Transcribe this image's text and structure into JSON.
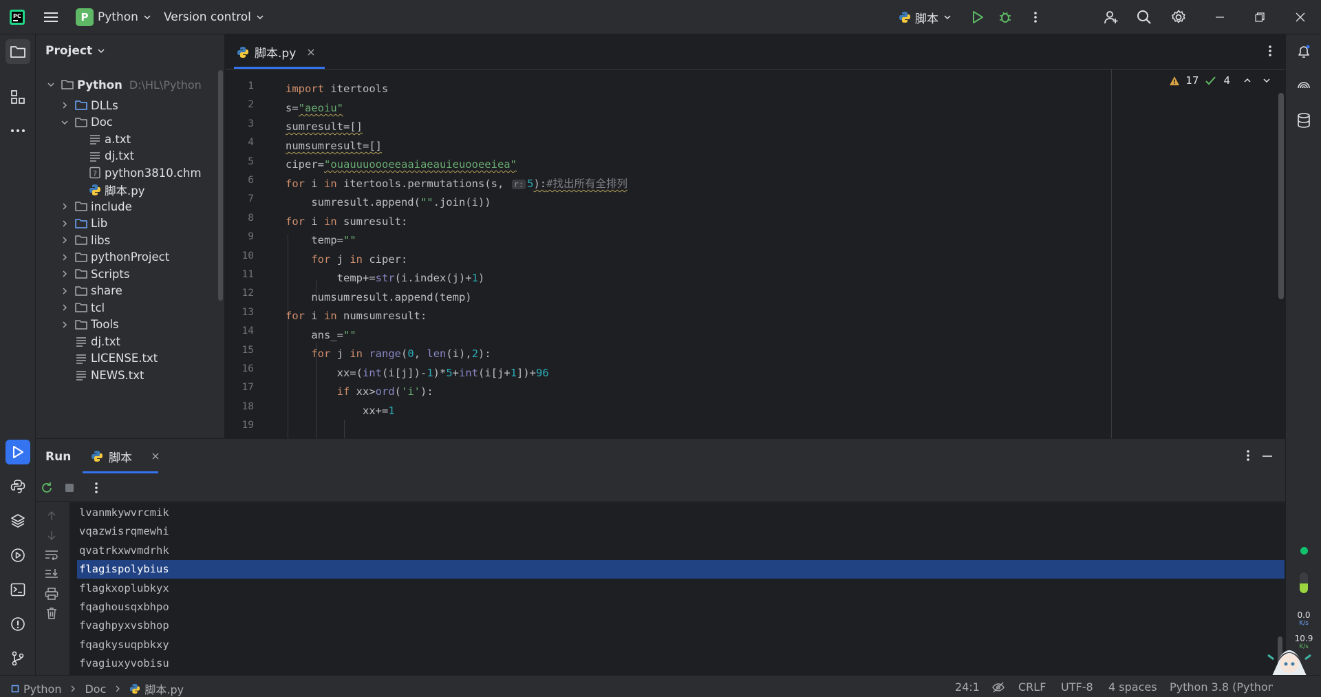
{
  "titlebar": {
    "menu_label": "Main Menu",
    "project_letter": "P",
    "project_name": "Python",
    "vcs_label": "Version control",
    "run_config": "脚本"
  },
  "project_panel": {
    "title": "Project",
    "root_name": "Python",
    "root_path": "D:\\HL\\Python",
    "items": [
      {
        "label": "DLLs",
        "type": "folder-blue"
      },
      {
        "label": "Doc",
        "type": "folder-open"
      },
      {
        "label": "a.txt",
        "type": "text"
      },
      {
        "label": "dj.txt",
        "type": "text"
      },
      {
        "label": "python3810.chm",
        "type": "chm"
      },
      {
        "label": "脚本.py",
        "type": "python"
      },
      {
        "label": "include",
        "type": "folder"
      },
      {
        "label": "Lib",
        "type": "folder-blue"
      },
      {
        "label": "libs",
        "type": "folder"
      },
      {
        "label": "pythonProject",
        "type": "folder"
      },
      {
        "label": "Scripts",
        "type": "folder"
      },
      {
        "label": "share",
        "type": "folder"
      },
      {
        "label": "tcl",
        "type": "folder"
      },
      {
        "label": "Tools",
        "type": "folder"
      },
      {
        "label": "dj.txt",
        "type": "text"
      },
      {
        "label": "LICENSE.txt",
        "type": "text"
      },
      {
        "label": "NEWS.txt",
        "type": "text"
      }
    ]
  },
  "editor": {
    "tab_label": "脚本.py",
    "warnings_count": "17",
    "ok_count": "4",
    "line_numbers": [
      "1",
      "2",
      "3",
      "4",
      "5",
      "6",
      "7",
      "8",
      "9",
      "10",
      "11",
      "12",
      "13",
      "14",
      "15",
      "16",
      "17",
      "18",
      "19"
    ],
    "code": {
      "l1_kw": "import",
      "l1_rest": " itertools",
      "l2_a": "s=",
      "l2_str": "\"aeoiu\"",
      "l3": "sumresult=[]",
      "l4": "numsumresult=[]",
      "l5_a": "ciper=",
      "l5_str": "\"ouauuuoooeeaaiaeauieuooeeiea\"",
      "l6_kw1": "for",
      "l6_b": " i ",
      "l6_kw2": "in",
      "l6_c": " itertools.permutations(s, ",
      "l6_hint": "r:",
      "l6_num": "5",
      "l6_d": "):",
      "l6_cmt": "#找出所有全排列",
      "l7_a": "    sumresult.append(",
      "l7_str": "\"\"",
      "l7_b": ".join(i))",
      "l8_kw1": "for",
      "l8_b": " i ",
      "l8_kw2": "in",
      "l8_c": " sumresult:",
      "l9_a": "    temp=",
      "l9_str": "\"\"",
      "l10_kw1": "for",
      "l10_b": " j ",
      "l10_kw2": "in",
      "l10_c": " ciper:",
      "l11_a": "        temp+=",
      "l11_bi": "str",
      "l11_b": "(i.index(j)+",
      "l11_num": "1",
      "l11_c": ")",
      "l12": "    numsumresult.append(temp)",
      "l13_kw1": "for",
      "l13_b": " i ",
      "l13_kw2": "in",
      "l13_c": " numsumresult:",
      "l14_a": "    ans_=",
      "l14_str": "\"\"",
      "l15_kw1": "for",
      "l15_b": " j ",
      "l15_kw2": "in",
      "l15_bi1": "range",
      "l15_c": "(",
      "l15_num1": "0",
      "l15_d": ", ",
      "l15_bi2": "len",
      "l15_e": "(i),",
      "l15_num2": "2",
      "l15_f": "):",
      "l16_a": "        xx=(",
      "l16_bi1": "int",
      "l16_b": "(i[j])-",
      "l16_num1": "1",
      "l16_c": ")*",
      "l16_num2": "5",
      "l16_d": "+",
      "l16_bi2": "int",
      "l16_e": "(i[j+",
      "l16_num3": "1",
      "l16_f": "])+",
      "l16_num4": "96",
      "l17_kw": "if",
      "l17_a": " xx>",
      "l17_bi": "ord",
      "l17_b": "(",
      "l17_str": "'i'",
      "l17_c": "):",
      "l18_a": "            xx+=",
      "l18_num": "1"
    }
  },
  "run_panel": {
    "title": "Run",
    "tab_label": "脚本",
    "output": [
      "lvanmkywvrcmik",
      "vqazwisrqmewhi",
      "qvatrkxwvmdrhk",
      "flagispolybius",
      "flagkxoplubkyx",
      "fqaghousqxbhpo",
      "fvaghpyxvsbhop",
      "fqagkysuqpbkxy",
      "fvagiuxyvobisu"
    ],
    "selected_index": 3
  },
  "right_stripe": {
    "up_speed": "0.0",
    "up_unit": "K/s",
    "down_speed": "10.9",
    "down_unit": "K/s"
  },
  "statusbar": {
    "crumb1": "Python",
    "crumb2": "Doc",
    "crumb3": "脚本.py",
    "position": "24:1",
    "line_sep": "CRLF",
    "encoding": "UTF-8",
    "indent": "4 spaces",
    "interpreter": "Python 3.8 (Python"
  },
  "colors": {
    "accent": "#3574f0",
    "selection": "#214283",
    "keyword": "#cf8e6d",
    "string": "#6aab73",
    "number": "#2aacb8",
    "project_badge": "#5fb865"
  }
}
